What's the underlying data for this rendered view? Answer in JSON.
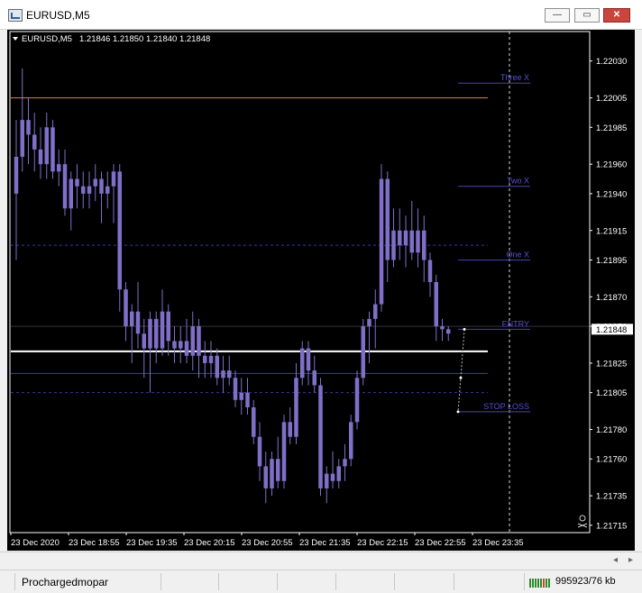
{
  "window": {
    "title": "EURUSD,M5",
    "min_icon": "minimize-icon",
    "max_icon": "maximize-icon",
    "close_icon": "close-icon",
    "min_glyph": "—",
    "max_glyph": "▭",
    "close_glyph": "✕"
  },
  "chart_header": {
    "symbol": "EURUSD,M5",
    "ohlc": "1.21846 1.21850 1.21840 1.21848"
  },
  "colors": {
    "background": "#000000",
    "candle": "#7f6fc8",
    "level_lines": "#4a41b8",
    "orange_line": "#d08a5a",
    "white_line": "#ffffff",
    "axis_text": "#ffffff",
    "label_text": "#5a4fd0"
  },
  "chart_data": {
    "type": "candlestick",
    "symbol": "EURUSD",
    "timeframe": "M5",
    "ylim": [
      1.2171,
      1.2205
    ],
    "y_ticks": [
      "1.22030",
      "1.22005",
      "1.21985",
      "1.21960",
      "1.21940",
      "1.21915",
      "1.21895",
      "1.21870",
      "1.21850",
      "1.21825",
      "1.21805",
      "1.21780",
      "1.21760",
      "1.21735",
      "1.21715"
    ],
    "current_price": "1.21848",
    "x_ticks": [
      "23 Dec 2020",
      "23 Dec 18:55",
      "23 Dec 19:35",
      "23 Dec 20:15",
      "23 Dec 20:55",
      "23 Dec 21:35",
      "23 Dec 22:15",
      "23 Dec 22:55",
      "23 Dec 23:35"
    ],
    "candles": [
      [
        1.2194,
        1.2199,
        1.21895,
        1.21965
      ],
      [
        1.21965,
        1.22025,
        1.21955,
        1.2199
      ],
      [
        1.2199,
        1.22005,
        1.2196,
        1.2198
      ],
      [
        1.2198,
        1.21995,
        1.21955,
        1.2197
      ],
      [
        1.2197,
        1.21985,
        1.2195,
        1.2196
      ],
      [
        1.2196,
        1.21995,
        1.2195,
        1.21985
      ],
      [
        1.21985,
        1.2199,
        1.2195,
        1.21955
      ],
      [
        1.21955,
        1.2197,
        1.21945,
        1.2196
      ],
      [
        1.2196,
        1.2197,
        1.21925,
        1.2193
      ],
      [
        1.2193,
        1.21955,
        1.21915,
        1.2195
      ],
      [
        1.2195,
        1.2196,
        1.2193,
        1.21945
      ],
      [
        1.21945,
        1.21955,
        1.2193,
        1.2194
      ],
      [
        1.2194,
        1.21955,
        1.2193,
        1.21945
      ],
      [
        1.21945,
        1.2196,
        1.21935,
        1.2195
      ],
      [
        1.2195,
        1.21955,
        1.2192,
        1.2194
      ],
      [
        1.2194,
        1.21955,
        1.2193,
        1.21945
      ],
      [
        1.21945,
        1.2196,
        1.2192,
        1.21955
      ],
      [
        1.21955,
        1.2196,
        1.2186,
        1.21875
      ],
      [
        1.21875,
        1.2188,
        1.2184,
        1.2185
      ],
      [
        1.2185,
        1.21865,
        1.21825,
        1.2186
      ],
      [
        1.2186,
        1.2188,
        1.21835,
        1.21845
      ],
      [
        1.21845,
        1.21855,
        1.21815,
        1.21835
      ],
      [
        1.21835,
        1.2186,
        1.21805,
        1.21855
      ],
      [
        1.21855,
        1.2186,
        1.21825,
        1.21835
      ],
      [
        1.21835,
        1.21875,
        1.2183,
        1.2186
      ],
      [
        1.2186,
        1.21865,
        1.2183,
        1.2184
      ],
      [
        1.2184,
        1.2185,
        1.21825,
        1.21835
      ],
      [
        1.21835,
        1.2185,
        1.21825,
        1.2184
      ],
      [
        1.2184,
        1.21855,
        1.21825,
        1.2183
      ],
      [
        1.2183,
        1.2186,
        1.2182,
        1.2185
      ],
      [
        1.2185,
        1.21855,
        1.21815,
        1.2183
      ],
      [
        1.2183,
        1.2184,
        1.21815,
        1.21825
      ],
      [
        1.21825,
        1.2184,
        1.21815,
        1.2183
      ],
      [
        1.2183,
        1.21835,
        1.2181,
        1.21815
      ],
      [
        1.21815,
        1.2183,
        1.21805,
        1.2182
      ],
      [
        1.2182,
        1.2183,
        1.2181,
        1.21815
      ],
      [
        1.21815,
        1.2182,
        1.21795,
        1.218
      ],
      [
        1.218,
        1.21815,
        1.2179,
        1.21805
      ],
      [
        1.21805,
        1.21815,
        1.2179,
        1.21795
      ],
      [
        1.21795,
        1.218,
        1.2177,
        1.21775
      ],
      [
        1.21775,
        1.21785,
        1.21745,
        1.21755
      ],
      [
        1.21755,
        1.21765,
        1.2173,
        1.2174
      ],
      [
        1.2174,
        1.21765,
        1.21735,
        1.2176
      ],
      [
        1.2176,
        1.21775,
        1.2174,
        1.21745
      ],
      [
        1.21745,
        1.2179,
        1.2174,
        1.21785
      ],
      [
        1.21785,
        1.21795,
        1.2177,
        1.21775
      ],
      [
        1.21775,
        1.21825,
        1.2177,
        1.21815
      ],
      [
        1.21815,
        1.2184,
        1.2181,
        1.21835
      ],
      [
        1.21835,
        1.2184,
        1.2181,
        1.2182
      ],
      [
        1.2182,
        1.2183,
        1.21805,
        1.2181
      ],
      [
        1.2181,
        1.21815,
        1.21735,
        1.2174
      ],
      [
        1.2174,
        1.21755,
        1.2173,
        1.2175
      ],
      [
        1.2175,
        1.21765,
        1.2174,
        1.21745
      ],
      [
        1.21745,
        1.2176,
        1.2174,
        1.21755
      ],
      [
        1.21755,
        1.2177,
        1.21745,
        1.2176
      ],
      [
        1.2176,
        1.2179,
        1.21755,
        1.21785
      ],
      [
        1.21785,
        1.2182,
        1.2178,
        1.21815
      ],
      [
        1.21815,
        1.21855,
        1.2181,
        1.2185
      ],
      [
        1.2185,
        1.2186,
        1.21825,
        1.21855
      ],
      [
        1.21855,
        1.21875,
        1.21835,
        1.21865
      ],
      [
        1.21865,
        1.2196,
        1.2186,
        1.2195
      ],
      [
        1.2195,
        1.21955,
        1.2188,
        1.21895
      ],
      [
        1.21895,
        1.2193,
        1.2189,
        1.21915
      ],
      [
        1.21915,
        1.2193,
        1.21895,
        1.21905
      ],
      [
        1.21905,
        1.21925,
        1.2189,
        1.21915
      ],
      [
        1.21915,
        1.21935,
        1.21895,
        1.219
      ],
      [
        1.219,
        1.2193,
        1.2189,
        1.21915
      ],
      [
        1.21915,
        1.21925,
        1.2188,
        1.21895
      ],
      [
        1.21895,
        1.219,
        1.2187,
        1.2188
      ],
      [
        1.2188,
        1.21885,
        1.2184,
        1.2185
      ],
      [
        1.2185,
        1.21855,
        1.2184,
        1.21848
      ],
      [
        1.21845,
        1.2185,
        1.2184,
        1.21848
      ]
    ],
    "levels": [
      {
        "label": "Three X",
        "price": 1.22015,
        "style": "solid"
      },
      {
        "label": "Two X",
        "price": 1.21945,
        "style": "solid"
      },
      {
        "label": "One X",
        "price": 1.21895,
        "style": "solid"
      },
      {
        "label": "ENTRY",
        "price": 1.21848,
        "style": "solid"
      },
      {
        "label": "STOP LOSS",
        "price": 1.21792,
        "style": "solid"
      }
    ],
    "horizontal_lines": [
      {
        "price": 1.22005,
        "color": "#d08a5a",
        "style": "solid"
      },
      {
        "price": 1.21905,
        "color": "#3a36a8",
        "style": "dashed"
      },
      {
        "price": 1.21833,
        "color": "#ffffff",
        "style": "solid"
      },
      {
        "price": 1.21818,
        "color": "#3a3ac8",
        "style": "solid"
      },
      {
        "price": 1.21805,
        "color": "#3a36a8",
        "style": "dashed"
      },
      {
        "price": 1.2185,
        "color": "#555555",
        "style": "solid"
      }
    ],
    "grid": false
  },
  "scrollbar": {
    "left_arrow": "◂",
    "right_arrow": "▸"
  },
  "status": {
    "profile": "Prochargedmopar",
    "traffic": "995923/76 kb",
    "signal_icon": "connection-bars-icon"
  }
}
